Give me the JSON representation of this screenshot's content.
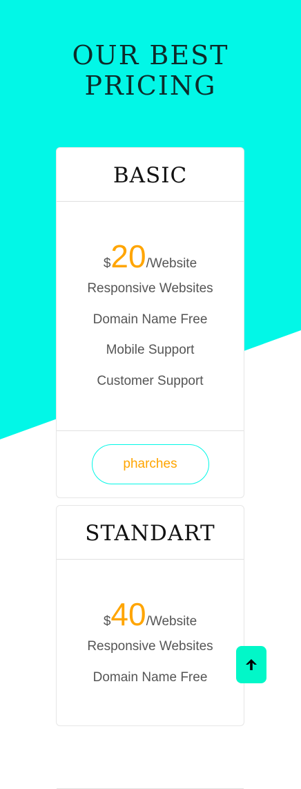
{
  "section": {
    "title_line1": "OUR BEST",
    "title_line2": "PRICING"
  },
  "plans": [
    {
      "name": "BASIC",
      "currency": "$",
      "price": "20",
      "per": "/Website",
      "features": [
        "Responsive Websites",
        "Domain Name Free",
        "Mobile Support",
        "Customer Support"
      ],
      "button_label": "pharches"
    },
    {
      "name": "STANDART",
      "currency": "$",
      "price": "40",
      "per": "/Website",
      "features": [
        "Responsive Websites",
        "Domain Name Free"
      ]
    }
  ],
  "scroll_top": {
    "icon": "arrow-up-icon"
  },
  "colors": {
    "accent": "#02f7e7",
    "price": "#ffa500",
    "text": "#555555",
    "heading": "#0d2b2a",
    "scroll_button": "#02f7c8"
  }
}
